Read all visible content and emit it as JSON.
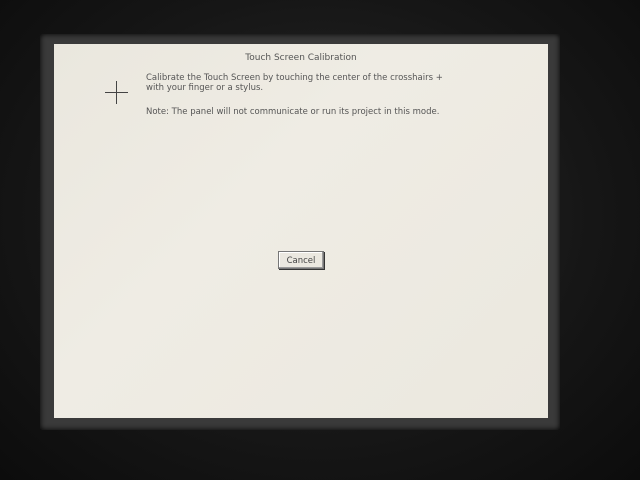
{
  "window": {
    "title": "Touch Screen Calibration"
  },
  "calibration": {
    "crosshair_icon": "crosshair-icon",
    "instructions_line1": "Calibrate the Touch Screen by touching the center of the crosshairs +",
    "instructions_line2": "with your finger or a stylus.",
    "note": "Note: The panel will not communicate or run its project in this mode."
  },
  "actions": {
    "cancel_label": "Cancel"
  }
}
